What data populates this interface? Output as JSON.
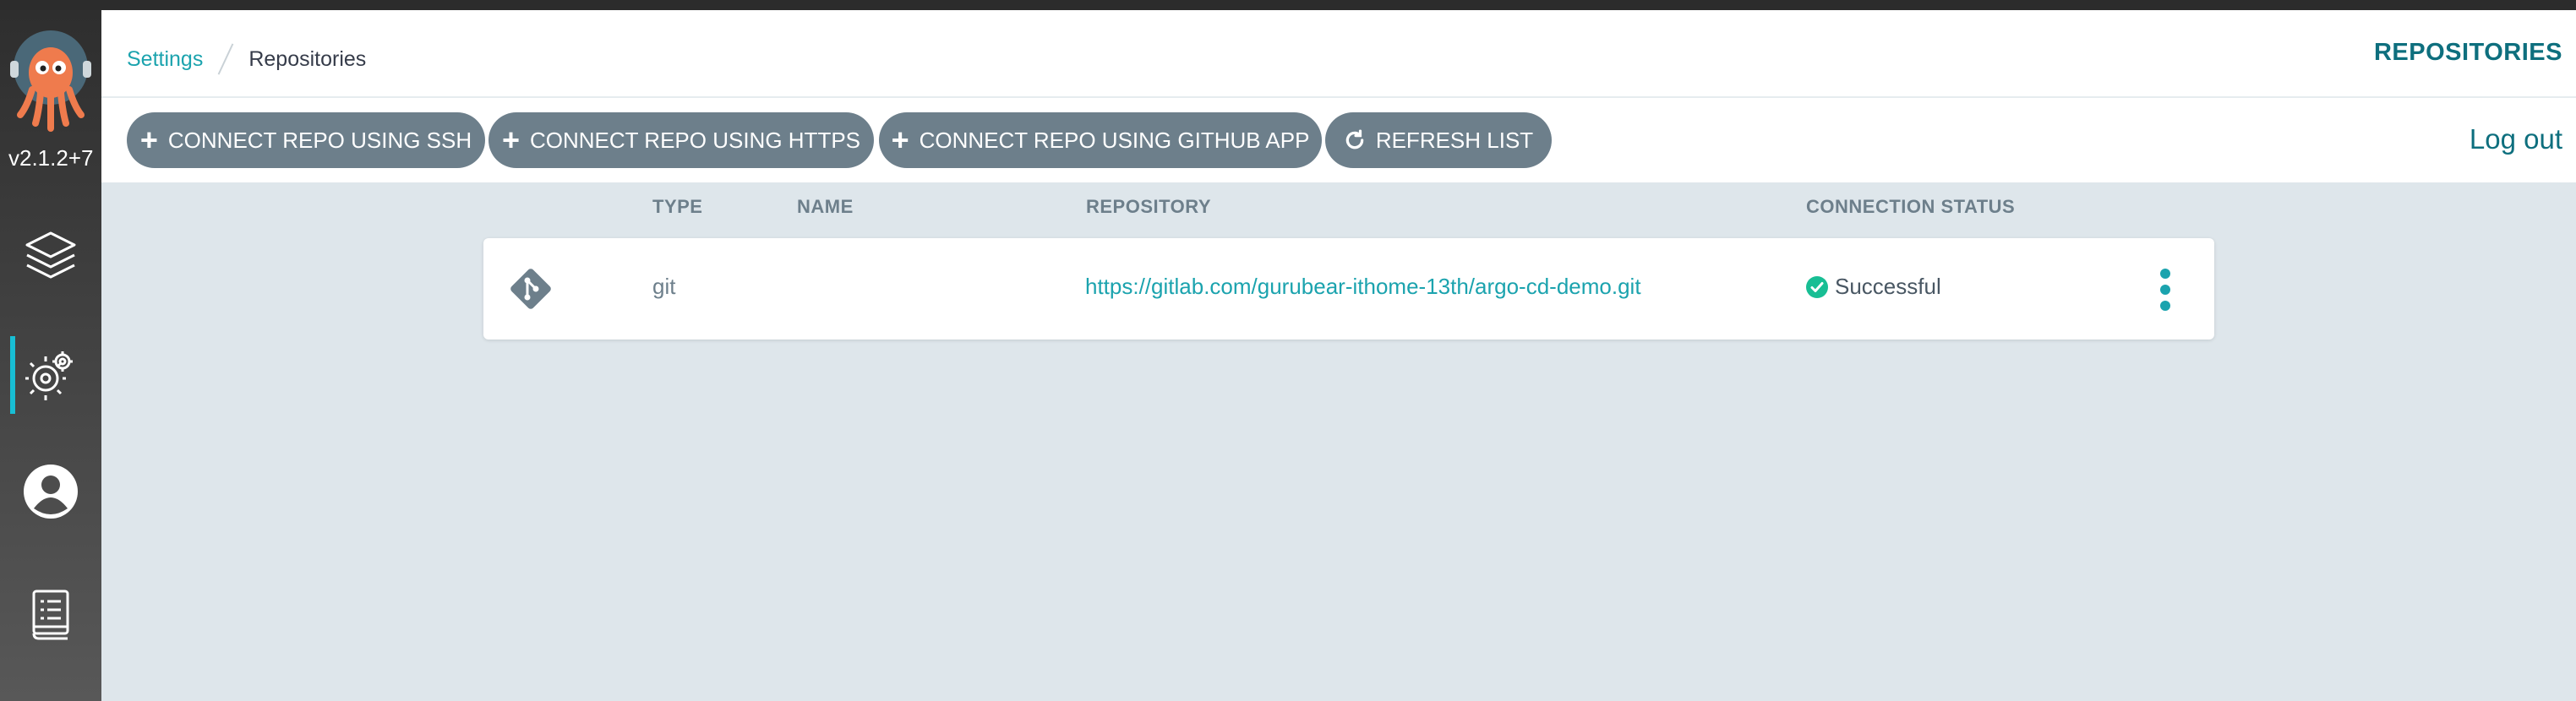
{
  "sidebar": {
    "version": "v2.1.2+7",
    "nav": [
      {
        "icon": "layers-icon"
      },
      {
        "icon": "gears-icon",
        "active": true
      },
      {
        "icon": "user-icon"
      },
      {
        "icon": "docs-icon"
      }
    ]
  },
  "header": {
    "breadcrumb": {
      "parent": "Settings",
      "current": "Repositories"
    },
    "title": "REPOSITORIES"
  },
  "toolbar": {
    "ssh_label": "CONNECT REPO USING SSH",
    "https_label": "CONNECT REPO USING HTTPS",
    "github_label": "CONNECT REPO USING GITHUB APP",
    "refresh_label": "REFRESH LIST",
    "logout_label": "Log out"
  },
  "table": {
    "columns": [
      "TYPE",
      "NAME",
      "REPOSITORY",
      "CONNECTION STATUS"
    ],
    "rows": [
      {
        "type": "git",
        "name": "",
        "repository": "https://gitlab.com/gurubear-ithome-13th/argo-cd-demo.git",
        "status": "Successful"
      }
    ]
  },
  "colors": {
    "accent": "#1ba3ae",
    "button": "#6d7f8b",
    "success": "#18be94",
    "background": "#dee6eb"
  }
}
